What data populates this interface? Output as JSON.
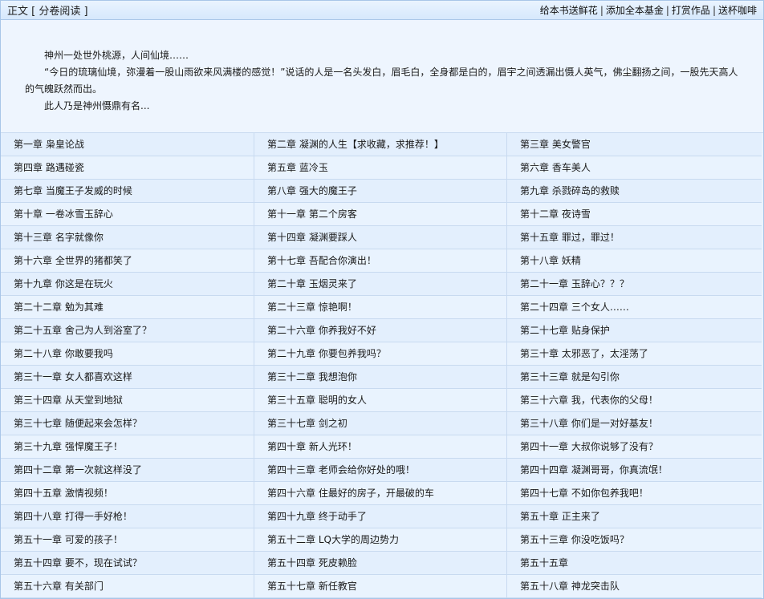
{
  "header": {
    "title": "正文",
    "subtitle": "[ 分卷阅读 ]",
    "actions": [
      "给本书送鲜花",
      "添加全本基金",
      "打赏作品",
      "送杯咖啡"
    ],
    "separator": "|"
  },
  "intro": {
    "paragraphs": [
      "神州一处世外桃源，人间仙境……",
      "“今日的琉璃仙境，弥漫着一股山雨欲来风满楼的感觉！”说话的人是一名头发白，眉毛白，全身都是白的，眉宇之间透漏出慑人英气，佛尘翻扬之间，一股先天高人的气魄跃然而出。",
      "此人乃是神州慑鼎有名..."
    ]
  },
  "chapters": [
    "第一章 枭皇论战",
    "第二章 凝渊的人生【求收藏，求推荐！】",
    "第三章 美女警官",
    "第四章 路遇碰瓷",
    "第五章 蓝冷玉",
    "第六章 香车美人",
    "第七章 当魔王子发威的时候",
    "第八章 强大的魔王子",
    "第九章 杀戮碎岛的救赎",
    "第十章 一卷冰雪玉辞心",
    "第十一章 第二个房客",
    "第十二章 夜诗雪",
    "第十三章 名字就像你",
    "第十四章 凝渊要踩人",
    "第十五章 罪过，罪过！",
    "第十六章 全世界的猪都笑了",
    "第十七章 吾配合你演出！",
    "第十八章 妖精",
    "第十九章 你这是在玩火",
    "第二十章 玉烟灵来了",
    "第二十一章 玉辞心？？？",
    "第二十二章 勉为其难",
    "第二十三章 惊艳啊！",
    "第二十四章 三个女人……",
    "第二十五章 舍己为人到浴室了？",
    "第二十六章 你养我好不好",
    "第二十七章 贴身保护",
    "第二十八章 你敢要我吗",
    "第二十九章 你要包养我吗？",
    "第三十章 太邪恶了，太淫荡了",
    "第三十一章 女人都喜欢这样",
    "第三十二章 我想泡你",
    "第三十三章 就是勾引你",
    "第三十四章 从天堂到地狱",
    "第三十五章 聪明的女人",
    "第三十六章 我，代表你的父母！",
    "第三十七章 随便起来会怎样？",
    "第三十七章 剑之初",
    "第三十八章 你们是一对好基友！",
    "第三十九章 强悍魔王子！",
    "第四十章 新人光环！",
    "第四十一章 大叔你说够了没有？",
    "第四十二章 第一次就这样没了",
    "第四十三章 老师会给你好处的哦！",
    "第四十四章 凝渊哥哥，你真流氓！",
    "第四十五章 激情视频！",
    "第四十六章 住最好的房子，开最破的车",
    "第四十七章 不如你包养我吧！",
    "第四十八章 打得一手好枪！",
    "第四十九章 终于动手了",
    "第五十章 正主来了",
    "第五十一章 可爱的孩子！",
    "第五十二章 LQ大学的周边势力",
    "第五十三章 你没吃饭吗？",
    "第五十四章 要不，现在试试？",
    "第五十四章 死皮赖脸",
    "第五十五章",
    "第五十六章 有关部门",
    "第五十七章 新任教官",
    "第五十八章 神龙突击队"
  ]
}
